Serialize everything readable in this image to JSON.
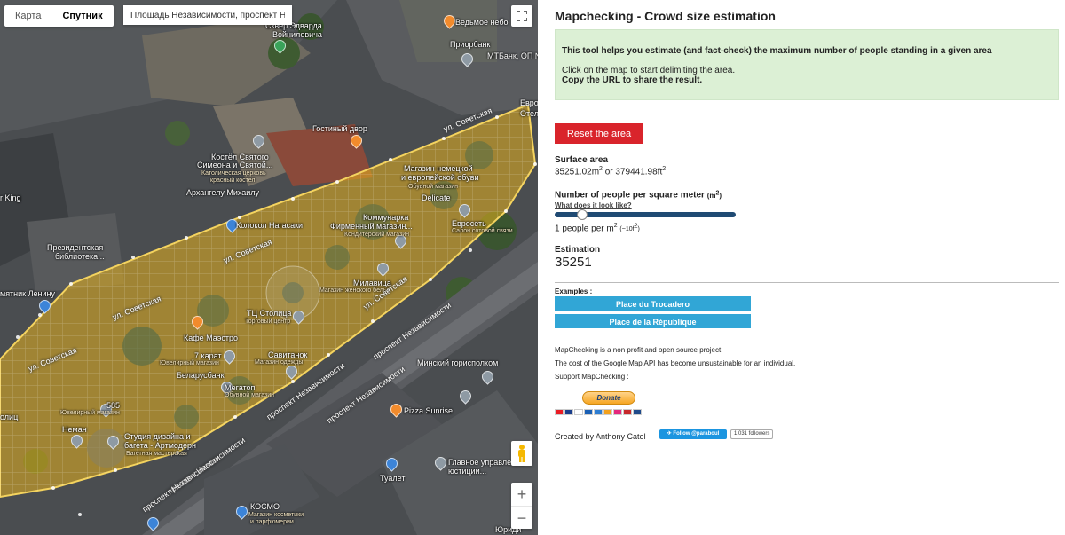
{
  "map": {
    "type_control": {
      "map_label": "Карта",
      "satellite_label": "Спутник",
      "active": "satellite"
    },
    "search": {
      "value": "Площадь Независимости, проспект Н..."
    },
    "fullscreen_icon": "fullscreen-icon",
    "pegman_icon": "pegman-icon",
    "zoom": {
      "in_label": "+",
      "out_label": "−"
    },
    "polygon_color": "#e8b21e",
    "labels": [
      {
        "text": "Кафе Маэстро"
      },
      {
        "text": "ТЦ Столица"
      },
      {
        "text": "Торговый центр"
      },
      {
        "text": "Гостиный двор"
      },
      {
        "text": "Костёл Святого"
      },
      {
        "text": "Симеона и Святой..."
      },
      {
        "text": "Католическая церковь"
      },
      {
        "text": "красный костел"
      },
      {
        "text": "Архангелу Михаилу"
      },
      {
        "text": "Колокол Нагасаки"
      },
      {
        "text": "Магазин немецкой"
      },
      {
        "text": "и европейской обуви"
      },
      {
        "text": "Обувной магазин"
      },
      {
        "text": "Delicate"
      },
      {
        "text": "Коммунарка"
      },
      {
        "text": "Фирменный магазин..."
      },
      {
        "text": "Кондитерский магазин"
      },
      {
        "text": "Евросеть"
      },
      {
        "text": "Салон сотовой связи"
      },
      {
        "text": "Милавица"
      },
      {
        "text": "Магазин женского белья"
      },
      {
        "text": "Президентская"
      },
      {
        "text": "библиотека..."
      },
      {
        "text": "мятник Ленину"
      },
      {
        "text": "7 карат"
      },
      {
        "text": "Ювелирный магазин"
      },
      {
        "text": "Савитанок"
      },
      {
        "text": "Магазин одежды"
      },
      {
        "text": "Беларусбанк"
      },
      {
        "text": "Мегатоп"
      },
      {
        "text": "Обувной магазин"
      },
      {
        "text": "585"
      },
      {
        "text": "Ювелирный магазин"
      },
      {
        "text": "Неман"
      },
      {
        "text": "Студия дизайна и"
      },
      {
        "text": "багета - Артмодерн"
      },
      {
        "text": "Багетная мастерская"
      },
      {
        "text": "Минский горисполком"
      },
      {
        "text": "Pizza Sunrise"
      },
      {
        "text": "Главное управление"
      },
      {
        "text": "юстиции..."
      },
      {
        "text": "Туалет"
      },
      {
        "text": "КОСМО"
      },
      {
        "text": "Магазин косметики"
      },
      {
        "text": "и парфюмерии"
      },
      {
        "text": "Ведьмое небо"
      },
      {
        "text": "Приорбанк"
      },
      {
        "text": "МТБанк, ОП №"
      },
      {
        "text": "Сквер Эдварда"
      },
      {
        "text": "Войниловича"
      },
      {
        "text": "Европ"
      },
      {
        "text": "Отел"
      },
      {
        "text": "r King"
      },
      {
        "text": "олиц"
      },
      {
        "text": "ул. Советская"
      },
      {
        "text": "ул. Советская"
      },
      {
        "text": "ул. Советская"
      },
      {
        "text": "ул. Советская"
      },
      {
        "text": "ул. Советская"
      },
      {
        "text": "проспект Независимости"
      },
      {
        "text": "проспект Независимости"
      },
      {
        "text": "проспект Независимости"
      },
      {
        "text": "проспект Независимости"
      },
      {
        "text": "проспект Независимости"
      },
      {
        "text": "Юриди"
      }
    ]
  },
  "panel": {
    "title": "Mapchecking - Crowd size estimation",
    "info": {
      "line1": "This tool helps you estimate (and fact-check) the maximum number of people standing in a given area",
      "line2": "Click on the map to start delimiting the area.",
      "line3": "Copy the URL to share the result."
    },
    "reset_label": "Reset the area",
    "surface": {
      "label": "Surface area",
      "m2_value": "35251.02m",
      "m2_sup": "2",
      "or": " or ",
      "ft_value": "379441.98ft",
      "ft_sup": "2"
    },
    "density": {
      "label": "Number of people per square meter",
      "unit": "(m",
      "unit_sup": "2",
      "unit_close": ")",
      "link": "What does it look like?",
      "value_text": "1 people per m",
      "value_sup": "2",
      "value_ft": "(~10f",
      "value_ft_sup": "2",
      "value_ft_close": ")",
      "slider_fraction": 0.15
    },
    "estimation": {
      "label": "Estimation",
      "value": "35251"
    },
    "examples": {
      "label": "Examples :",
      "buttons": [
        "Place du Trocadero",
        "Place de la République"
      ]
    },
    "footer": {
      "line1": "MapChecking is a non profit and open source project.",
      "line2": "The cost of the Google Map API has become unsustainable for an individual.",
      "line3": "Support MapChecking :",
      "donate_label": "Donate",
      "card_icons": [
        "mastercard-icon",
        "maestro-icon",
        "visa-icon",
        "visa-electron-icon",
        "amex-icon",
        "discover-icon",
        "paypal-icon",
        "jcb-icon",
        "bank-icon"
      ],
      "created_by": "Created by Anthony Catel",
      "twitter_label": "Follow @paraboul",
      "followers": "1,031 followers"
    },
    "colors": {
      "reset": "#d9242b",
      "example": "#31a6d6",
      "info_bg": "#dcf0d5",
      "slider": "#1f4a73"
    }
  }
}
